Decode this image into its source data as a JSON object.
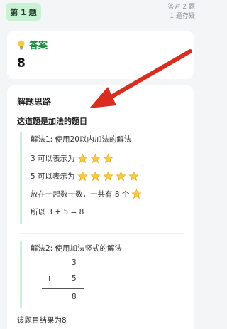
{
  "header": {
    "question_badge": "第 1 题",
    "stats_line1": "答对 2 题",
    "stats_line2": "1 题存疑"
  },
  "answer": {
    "title": "答案",
    "value": "8",
    "icon": "lightbulb-icon"
  },
  "solution": {
    "title": "解题思路",
    "subtitle": "这道题是加法的题目",
    "method1": {
      "title": "解法1: 使用20以内加法的解法",
      "line1": "3 可以表示为",
      "line1_stars": 3,
      "line2": "5 可以表示为",
      "line2_stars": 5,
      "line3": "放在一起数一数，一共有 8 个",
      "line3_stars": 1,
      "line4": "所以 3 + 5 = 8",
      "icon": "star-icon"
    },
    "method2": {
      "title": "解法2: 使用加法竖式的解法",
      "top_number": "3",
      "operator": "+",
      "second_number": "5",
      "result_number": "8"
    },
    "result": "该题目结果为8"
  },
  "colors": {
    "badge_bg": "#c9f2d5",
    "answer_green": "#178a3e",
    "arrow_red": "#d92d20",
    "star_yellow": "#f7c948"
  }
}
